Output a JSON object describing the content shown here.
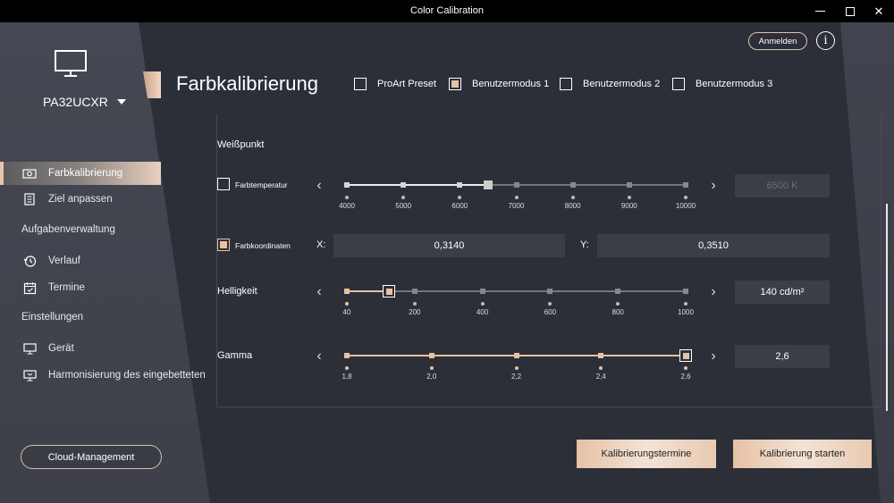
{
  "window": {
    "title": "Color Calibration"
  },
  "header": {
    "login_label": "Anmelden",
    "page_title": "Farbkalibrierung",
    "presets": [
      {
        "label": "ProArt Preset",
        "checked": false
      },
      {
        "label": "Benutzermodus 1",
        "checked": true
      },
      {
        "label": "Benutzermodus 2",
        "checked": false
      },
      {
        "label": "Benutzermodus 3",
        "checked": false
      }
    ]
  },
  "sidebar": {
    "device": "PA32UCXR",
    "items": [
      {
        "label": "Farbkalibrierung",
        "active": true
      },
      {
        "label": "Ziel anpassen"
      }
    ],
    "section_tasks": "Aufgabenverwaltung",
    "task_items": [
      {
        "label": "Verlauf"
      },
      {
        "label": "Termine"
      }
    ],
    "section_settings": "Einstellungen",
    "settings_items": [
      {
        "label": "Gerät"
      },
      {
        "label": "Harmonisierung des eingebetteten"
      }
    ],
    "cloud_label": "Cloud-Management"
  },
  "whitepoint": {
    "heading": "Weißpunkt",
    "temperature": {
      "label": "Farbtemperatur",
      "checked": false,
      "ticks": [
        "4000",
        "5000",
        "6000",
        "7000",
        "8000",
        "9000",
        "10000"
      ],
      "value": 6500,
      "display": "6500 K"
    },
    "coordinates": {
      "label": "Farbkoordinaten",
      "checked": true,
      "x_label": "X:",
      "x_value": "0,3140",
      "y_label": "Y:",
      "y_value": "0,3510"
    }
  },
  "brightness": {
    "label": "Helligkeit",
    "ticks": [
      "40",
      "200",
      "400",
      "600",
      "800",
      "1000"
    ],
    "value": 140,
    "display": "140 cd/m²"
  },
  "gamma": {
    "label": "Gamma",
    "ticks": [
      "1,8",
      "2,0",
      "2,2",
      "2,4",
      "2,6"
    ],
    "value": 2.6,
    "display": "2,6"
  },
  "actions": {
    "schedule_label": "Kalibrierungstermine",
    "start_label": "Kalibrierung starten"
  }
}
